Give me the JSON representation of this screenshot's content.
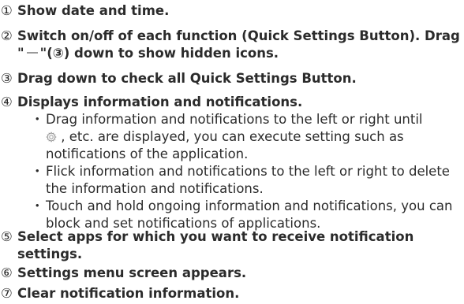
{
  "items": [
    {
      "num": "①",
      "text": "Show date and time."
    },
    {
      "num": "②",
      "text_a": "Switch on/off of each function (Quick Settings Button). Drag",
      "text_b_pre": "\"",
      "text_b_post": "\"(③) down to show hidden icons."
    },
    {
      "num": "③",
      "text": "Drag down to check all Quick Settings Button."
    },
    {
      "num": "④",
      "text": "Displays information and notifications.",
      "bullets": [
        {
          "dot": "・",
          "pre": "Drag information and notifications to the left or right until",
          "post": ", etc. are displayed, you can execute setting such as notifications of the application."
        },
        {
          "dot": "・",
          "text": "Flick information and notifications to the left or right to delete the information and notifications."
        },
        {
          "dot": "・",
          "text": "Touch and hold ongoing information and notifications, you can block and set notifications of applications."
        }
      ]
    },
    {
      "num": "⑤",
      "text": "Select apps for which you want to receive notification settings."
    },
    {
      "num": "⑥",
      "text": "Settings menu screen appears."
    },
    {
      "num": "⑦",
      "text": "Clear notification information."
    }
  ],
  "icons": {
    "gear": "gear-icon",
    "dash": "dash-icon"
  },
  "colors": {
    "text": "#2b2b2b",
    "icon": "#9a9a9a"
  }
}
